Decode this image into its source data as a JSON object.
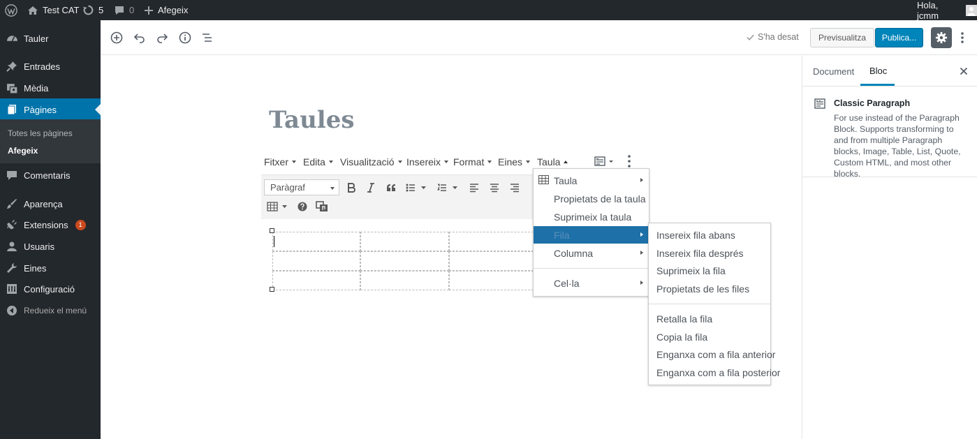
{
  "adminbar": {
    "site_name": "Test CAT",
    "updates_count": "5",
    "comments_count": "0",
    "new_label": "Afegeix",
    "greeting": "Hola, jcmm"
  },
  "sidebar": {
    "items": [
      {
        "label": "Tauler",
        "icon": "dashboard-icon"
      },
      {
        "label": "Entrades",
        "icon": "pin-icon"
      },
      {
        "label": "Mèdia",
        "icon": "media-icon"
      },
      {
        "label": "Pàgines",
        "icon": "pages-icon"
      },
      {
        "label": "Comentaris",
        "icon": "comments-icon"
      },
      {
        "label": "Aparença",
        "icon": "appearance-icon"
      },
      {
        "label": "Extensions",
        "icon": "plugins-icon",
        "badge": "1"
      },
      {
        "label": "Usuaris",
        "icon": "users-icon"
      },
      {
        "label": "Eines",
        "icon": "tools-icon"
      },
      {
        "label": "Configuració",
        "icon": "settings-icon"
      },
      {
        "label": "Redueix el menú",
        "icon": "collapse-icon"
      }
    ],
    "submenu": [
      "Totes les pàgines",
      "Afegeix"
    ]
  },
  "header": {
    "saved_label": "S'ha desat",
    "preview_label": "Previsualitza",
    "publish_label": "Publica..."
  },
  "editor": {
    "title": "Taules",
    "menubar": [
      "Fitxer",
      "Edita",
      "Visualització",
      "Insereix",
      "Format",
      "Eines",
      "Taula"
    ],
    "format_select": "Paràgraf"
  },
  "table_menu": {
    "items": [
      "Taula",
      "Propietats de la taula",
      "Suprimeix la taula",
      "Fila",
      "Columna",
      "Cel·la"
    ]
  },
  "row_menu": {
    "items": [
      "Insereix fila abans",
      "Insereix fila després",
      "Suprimeix la fila",
      "Propietats de les files",
      "Retalla la fila",
      "Copia la fila",
      "Enganxa com a fila anterior",
      "Enganxa com a fila posterior"
    ]
  },
  "right_panel": {
    "tab_document": "Document",
    "tab_block": "Bloc",
    "block_name": "Classic Paragraph",
    "block_description": "For use instead of the Paragraph Block. Supports transforming to and from multiple Paragraph blocks, Image, Table, List, Quote, Custom HTML, and most other blocks."
  },
  "colors": {
    "admin_dark": "#23282d",
    "accent_blue": "#0073aa",
    "publish_blue": "#0085ba",
    "badge_orange": "#ca4a1f"
  }
}
